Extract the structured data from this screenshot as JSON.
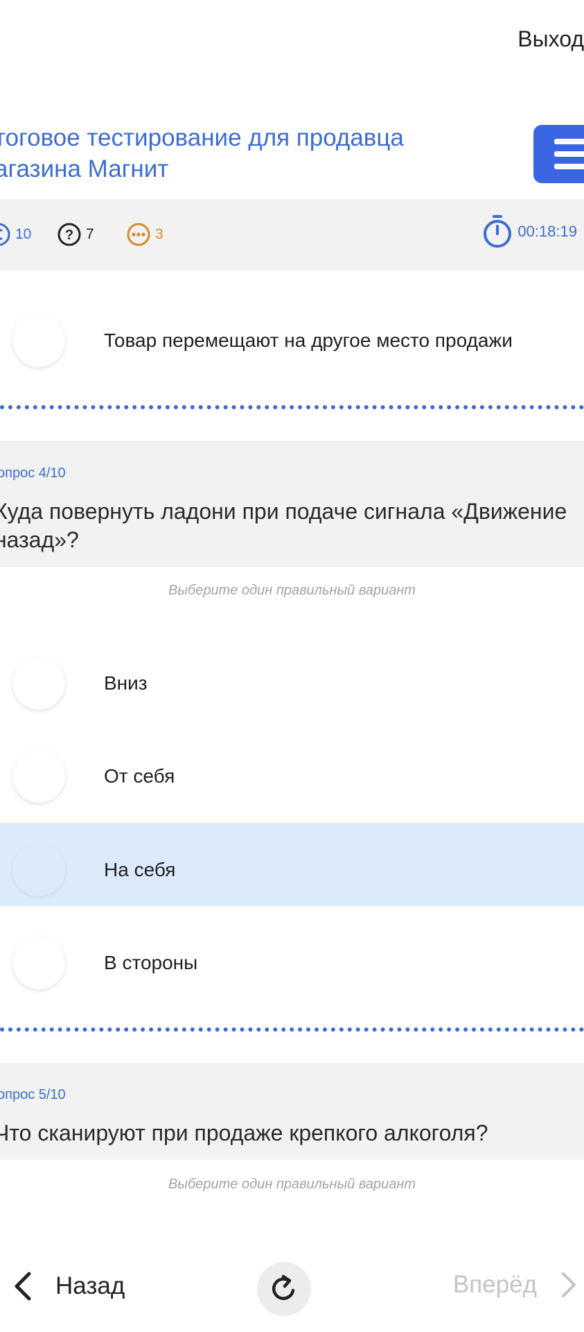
{
  "header": {
    "exit_label": "Выход",
    "title": "тоговое тестирование для продавца агазина Магнит"
  },
  "stats": {
    "total": "10",
    "unanswered": "7",
    "skipped": "3",
    "timer": "00:18:19"
  },
  "question3": {
    "options": [
      {
        "label": "Товар перемещают на другое место продажи",
        "selected": false
      }
    ]
  },
  "question4": {
    "number": "опрос 4/10",
    "text": "Куда повернуть ладони при подаче сигнала «Движение назад»?",
    "hint": "Выберите один правильный вариант",
    "options": [
      {
        "label": "Вниз",
        "selected": false
      },
      {
        "label": "От себя",
        "selected": false
      },
      {
        "label": "На себя",
        "selected": true
      },
      {
        "label": "В стороны",
        "selected": false
      }
    ]
  },
  "question5": {
    "number": "опрос 5/10",
    "text": "Что сканируют при продаже крепкого алкоголя?",
    "hint": "Выберите один правильный вариант"
  },
  "nav": {
    "back_label": "Назад",
    "forward_label": "Вперёд"
  },
  "colors": {
    "accent": "#3b66e3",
    "title_blue": "#3d6cd1",
    "skipped_orange": "#d48a2a",
    "selected_bg": "#dcebfc",
    "panel_bg": "#f2f2f2"
  }
}
